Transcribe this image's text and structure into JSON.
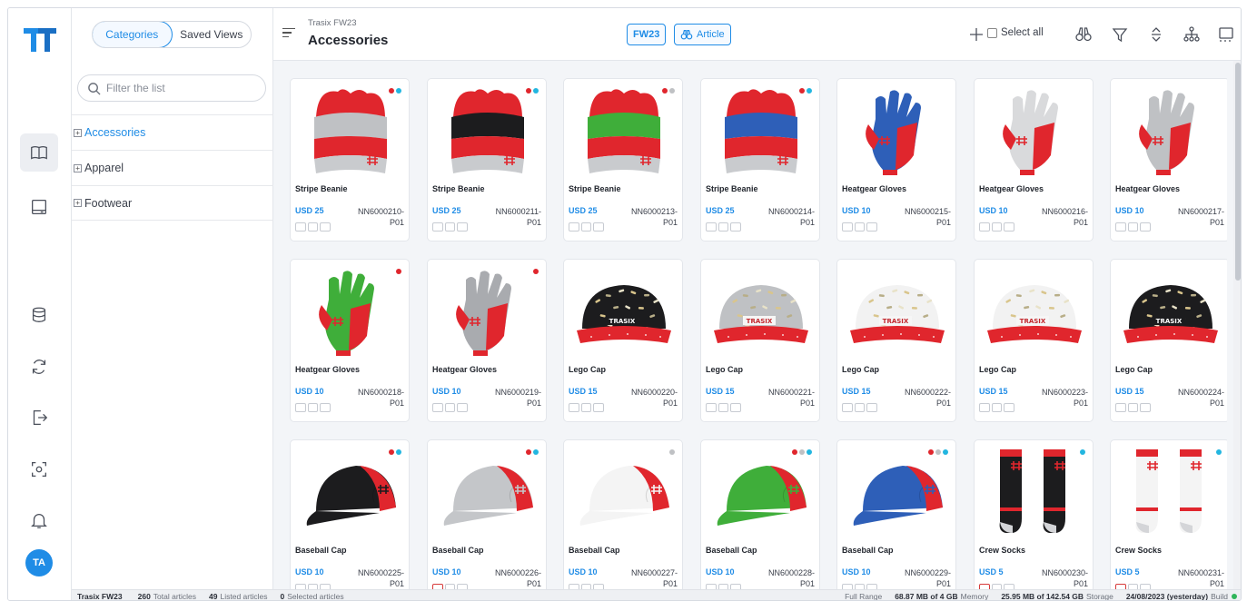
{
  "sidebar_tabs": {
    "categories": "Categories",
    "saved_views": "Saved Views"
  },
  "filter": {
    "placeholder": "Filter the list"
  },
  "tree": [
    {
      "label": "Accessories",
      "selected": true
    },
    {
      "label": "Apparel",
      "selected": false
    },
    {
      "label": "Footwear",
      "selected": false
    }
  ],
  "header": {
    "breadcrumb": "Trasix FW23",
    "title": "Accessories",
    "season_pill": "FW23",
    "article_pill": "Article",
    "select_all": "Select all"
  },
  "user": {
    "initials": "TA"
  },
  "colors": {
    "accent": "#1f8ce6",
    "red": "#e0262d",
    "blue": "#2e5fb8",
    "green": "#3fae3a",
    "gray": "#bfc1c4",
    "black": "#1c1c1e",
    "cyan": "#23b6e0"
  },
  "products": [
    {
      "name": "Stripe Beanie",
      "price": "USD 25",
      "code": "NN6000210-",
      "suffix": "P01",
      "kind": "beanie",
      "colors": [
        "#e0262d",
        "#bfc1c4"
      ],
      "dots": [
        "#e0262d",
        "#23b6e0"
      ]
    },
    {
      "name": "Stripe Beanie",
      "price": "USD 25",
      "code": "NN6000211-",
      "suffix": "P01",
      "kind": "beanie",
      "colors": [
        "#e0262d",
        "#1c1c1e"
      ],
      "dots": [
        "#e0262d",
        "#23b6e0"
      ]
    },
    {
      "name": "Stripe Beanie",
      "price": "USD 25",
      "code": "NN6000213-",
      "suffix": "P01",
      "kind": "beanie",
      "colors": [
        "#e0262d",
        "#3fae3a"
      ],
      "dots": [
        "#e0262d",
        "#bfc1c4"
      ]
    },
    {
      "name": "Stripe Beanie",
      "price": "USD 25",
      "code": "NN6000214-",
      "suffix": "P01",
      "kind": "beanie",
      "colors": [
        "#e0262d",
        "#2e5fb8"
      ],
      "dots": [
        "#e0262d",
        "#23b6e0"
      ]
    },
    {
      "name": "Heatgear Gloves",
      "price": "USD 10",
      "code": "NN6000215-",
      "suffix": "P01",
      "kind": "glove",
      "colors": [
        "#2e5fb8",
        "#e0262d"
      ],
      "dots": []
    },
    {
      "name": "Heatgear Gloves",
      "price": "USD 10",
      "code": "NN6000216-",
      "suffix": "P01",
      "kind": "glove",
      "colors": [
        "#d9dadc",
        "#e0262d"
      ],
      "dots": []
    },
    {
      "name": "Heatgear Gloves",
      "price": "USD 10",
      "code": "NN6000217-",
      "suffix": "P01",
      "kind": "glove",
      "colors": [
        "#bfc1c4",
        "#e0262d"
      ],
      "dots": []
    },
    {
      "name": "Heatgear Gloves",
      "price": "USD 10",
      "code": "NN6000218-",
      "suffix": "P01",
      "kind": "glove",
      "colors": [
        "#3fae3a",
        "#e0262d"
      ],
      "dots": [
        "#e0262d"
      ]
    },
    {
      "name": "Heatgear Gloves",
      "price": "USD 10",
      "code": "NN6000219-",
      "suffix": "P01",
      "kind": "glove",
      "colors": [
        "#a9abaf",
        "#e0262d"
      ],
      "dots": [
        "#e0262d"
      ]
    },
    {
      "name": "Lego Cap",
      "price": "USD 15",
      "code": "NN6000220-",
      "suffix": "P01",
      "kind": "snapback",
      "colors": [
        "#1c1c1e",
        "#e0262d"
      ],
      "dots": []
    },
    {
      "name": "Lego Cap",
      "price": "USD 15",
      "code": "NN6000221-",
      "suffix": "P01",
      "kind": "snapback",
      "colors": [
        "#bfc1c4",
        "#e0262d"
      ],
      "dots": []
    },
    {
      "name": "Lego Cap",
      "price": "USD 15",
      "code": "NN6000222-",
      "suffix": "P01",
      "kind": "snapback",
      "colors": [
        "#f2f2f2",
        "#e0262d"
      ],
      "dots": []
    },
    {
      "name": "Lego Cap",
      "price": "USD 15",
      "code": "NN6000223-",
      "suffix": "P01",
      "kind": "snapback",
      "colors": [
        "#f2f2f2",
        "#e0262d"
      ],
      "dots": []
    },
    {
      "name": "Lego Cap",
      "price": "USD 15",
      "code": "NN6000224-",
      "suffix": "P01",
      "kind": "snapback",
      "colors": [
        "#1c1c1e",
        "#e0262d"
      ],
      "dots": []
    },
    {
      "name": "Baseball Cap",
      "price": "USD 10",
      "code": "NN6000225-",
      "suffix": "P01",
      "kind": "cap",
      "colors": [
        "#1c1c1e",
        "#e0262d"
      ],
      "dots": [
        "#e0262d",
        "#23b6e0"
      ]
    },
    {
      "name": "Baseball Cap",
      "price": "USD 10",
      "code": "NN6000226-",
      "suffix": "P01",
      "kind": "cap",
      "colors": [
        "#c4c6c9",
        "#e0262d"
      ],
      "dots": [
        "#e0262d",
        "#23b6e0"
      ]
    },
    {
      "name": "Baseball Cap",
      "price": "USD 10",
      "code": "NN6000227-",
      "suffix": "P01",
      "kind": "cap",
      "colors": [
        "#f4f4f4",
        "#e0262d"
      ],
      "dots": [
        "#bfc1c4"
      ]
    },
    {
      "name": "Baseball Cap",
      "price": "USD 10",
      "code": "NN6000228-",
      "suffix": "P01",
      "kind": "cap",
      "colors": [
        "#3fae3a",
        "#e0262d"
      ],
      "dots": [
        "#e0262d",
        "#bfc1c4",
        "#23b6e0"
      ]
    },
    {
      "name": "Baseball Cap",
      "price": "USD 10",
      "code": "NN6000229-",
      "suffix": "P01",
      "kind": "cap",
      "colors": [
        "#2e5fb8",
        "#e0262d"
      ],
      "dots": [
        "#e0262d",
        "#bfc1c4",
        "#23b6e0"
      ]
    },
    {
      "name": "Crew Socks",
      "price": "USD 5",
      "code": "NN6000230-",
      "suffix": "P01",
      "kind": "socks",
      "colors": [
        "#1c1c1e",
        "#e0262d"
      ],
      "dots": [
        "#23b6e0"
      ]
    },
    {
      "name": "Crew Socks",
      "price": "USD 5",
      "code": "NN6000231-",
      "suffix": "P01",
      "kind": "socks",
      "colors": [
        "#f4f4f4",
        "#e0262d"
      ],
      "dots": [
        "#23b6e0"
      ]
    }
  ],
  "status": {
    "project": "Trasix FW23",
    "total_count": "260",
    "total_label": "Total articles",
    "listed_count": "49",
    "listed_label": "Listed articles",
    "selected_count": "0",
    "selected_label": "Selected articles",
    "range": "Full Range",
    "memory_value": "68.87 MB of 4 GB",
    "memory_label": "Memory",
    "storage_value": "25.95 MB of 142.54 GB",
    "storage_label": "Storage",
    "build_value": "24/08/2023 (yesterday)",
    "build_label": "Build"
  }
}
